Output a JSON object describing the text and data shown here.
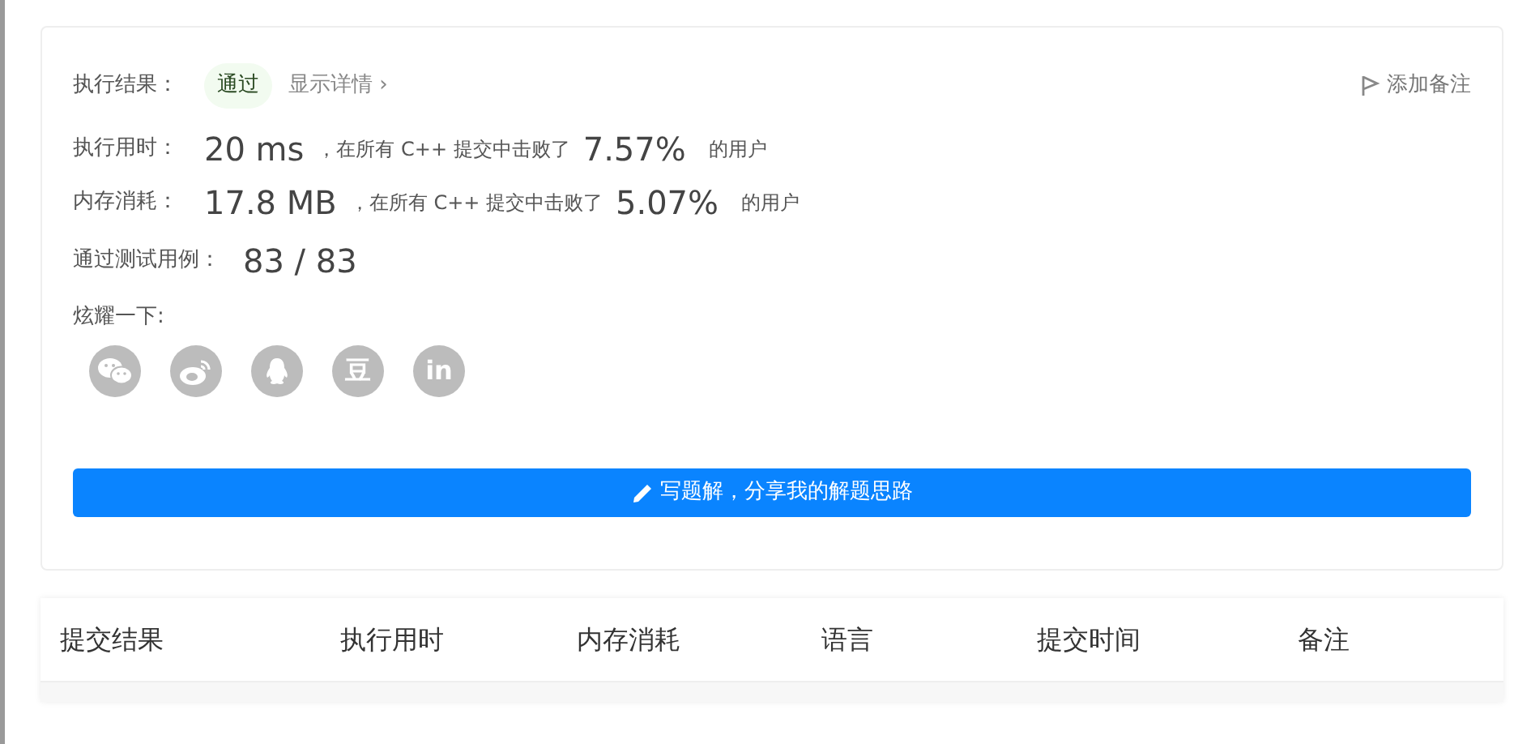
{
  "result": {
    "label": "执行结果：",
    "status": "通过",
    "details_link": "显示详情",
    "details_caret": "›",
    "add_note": "添加备注"
  },
  "stats": [
    {
      "label": "执行用时：",
      "value": "20 ms",
      "middle": "，在所有 C++ 提交中击败了",
      "percent": "7.57%",
      "suffix": "的用户"
    },
    {
      "label": "内存消耗：",
      "value": "17.8 MB",
      "middle": "，在所有 C++ 提交中击败了",
      "percent": "5.07%",
      "suffix": "的用户"
    }
  ],
  "testcases": {
    "label": "通过测试用例：",
    "value": "83 / 83"
  },
  "share": {
    "label": "炫耀一下:",
    "items": [
      {
        "kind": "wechat"
      },
      {
        "kind": "weibo"
      },
      {
        "kind": "qq"
      },
      {
        "kind": "glyph",
        "glyph": "豆"
      },
      {
        "kind": "glyph",
        "glyph": "in"
      }
    ]
  },
  "write_solution_button": "写题解，分享我的解题思路",
  "table": {
    "columns": [
      "提交结果",
      "执行用时",
      "内存消耗",
      "语言",
      "提交时间",
      "备注"
    ]
  }
}
